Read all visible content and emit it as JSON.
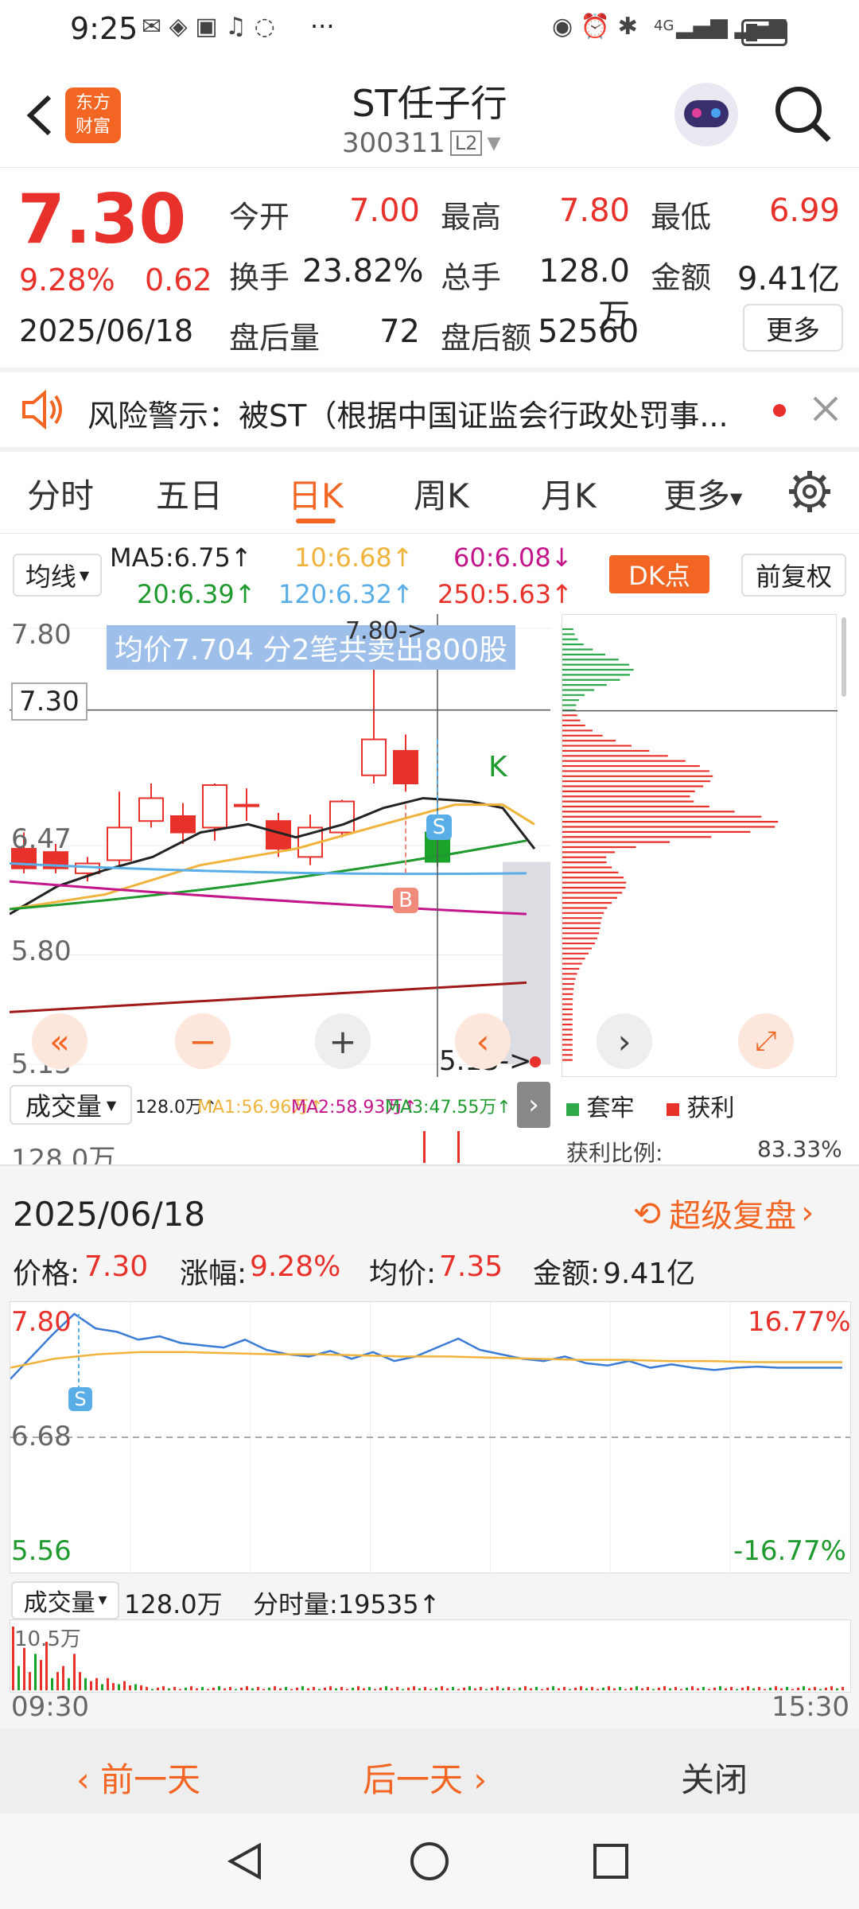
{
  "status_bar": {
    "time": "9:25",
    "dots": "···",
    "net": "4G"
  },
  "header": {
    "logo_line1": "东方",
    "logo_line2": "财富",
    "title": "ST任子行",
    "code": "300311",
    "level": "L2"
  },
  "quote": {
    "price": "7.30",
    "change_pct": "9.28%",
    "change": "0.62",
    "date": "2025/06/18",
    "open_label": "今开",
    "open": "7.00",
    "high_label": "最高",
    "high": "7.80",
    "low_label": "最低",
    "low": "6.99",
    "turnover_label": "换手",
    "turnover": "23.82%",
    "volume_label": "总手",
    "volume": "128.0万",
    "amount_label": "金额",
    "amount": "9.41亿",
    "after_vol_label": "盘后量",
    "after_vol": "72",
    "after_amt_label": "盘后额",
    "after_amt": "52560",
    "more_btn": "更多"
  },
  "risk": {
    "text": "风险警示：被ST（根据中国证监会行政处罚事..."
  },
  "tabs": [
    "分时",
    "五日",
    "日K",
    "周K",
    "月K",
    "更多",
    ""
  ],
  "active_tab": 2,
  "ma": {
    "selector": "均线",
    "ma5": "MA5:6.75↑",
    "ma10": "10:6.68↑",
    "ma60": "60:6.08↓",
    "ma20": "20:6.39↑",
    "ma120": "120:6.32↑",
    "ma250": "250:5.63↑",
    "dk_btn": "DK点",
    "fq_btn": "前复权",
    "colors": {
      "ma5": "#222222",
      "ma10": "#f0b33c",
      "ma20": "#1f9a2e",
      "ma60": "#c3168a",
      "ma120": "#5aaee8",
      "ma250": "#a01818"
    }
  },
  "kchart": {
    "y_labels": [
      "7.80",
      "6.47",
      "5.80",
      "5.13"
    ],
    "crosshair_price": "7.30",
    "tooltip": "均价7.704  分2笔共卖出800股",
    "max_marker": "7.80->",
    "min_marker": "5.13->",
    "s_marker": "S",
    "b_marker": "B",
    "k_marker": "K",
    "candles": [
      {
        "o": 6.45,
        "c": 6.33,
        "h": 6.55,
        "l": 6.3
      },
      {
        "o": 6.43,
        "c": 6.33,
        "h": 6.48,
        "l": 6.3
      },
      {
        "o": 6.3,
        "c": 6.36,
        "h": 6.4,
        "l": 6.25
      },
      {
        "o": 6.38,
        "c": 6.58,
        "h": 6.8,
        "l": 6.35
      },
      {
        "o": 6.62,
        "c": 6.76,
        "h": 6.85,
        "l": 6.58
      },
      {
        "o": 6.65,
        "c": 6.55,
        "h": 6.73,
        "l": 6.48
      },
      {
        "o": 6.58,
        "c": 6.84,
        "h": 6.85,
        "l": 6.5
      },
      {
        "o": 6.72,
        "c": 6.72,
        "h": 6.82,
        "l": 6.62
      },
      {
        "o": 6.62,
        "c": 6.45,
        "h": 6.67,
        "l": 6.4
      },
      {
        "o": 6.4,
        "c": 6.58,
        "h": 6.66,
        "l": 6.35
      },
      {
        "o": 6.55,
        "c": 6.74,
        "h": 6.75,
        "l": 6.52
      },
      {
        "o": 6.9,
        "c": 7.12,
        "h": 7.8,
        "l": 6.85
      },
      {
        "o": 7.05,
        "c": 6.85,
        "h": 7.15,
        "l": 6.8
      },
      {
        "o": 6.55,
        "c": 6.37,
        "h": 6.6,
        "l": 6.34
      }
    ]
  },
  "chip": {
    "legend_trapped": "套牢",
    "legend_profit": "获利",
    "profit_ratio_label": "获利比例:",
    "profit_ratio": "83.33%"
  },
  "volume_bar": {
    "selector": "成交量",
    "vol": "128.0万↑",
    "ma1": "MA1:56.96万↑",
    "ma2": "MA2:58.93万↑",
    "ma3": "MA3:47.55万↑",
    "axis": "128.0万"
  },
  "intraday": {
    "date": "2025/06/18",
    "replay_btn": "超级复盘",
    "price_label": "价格:",
    "price": "7.30",
    "chg_label": "涨幅:",
    "chg": "9.28%",
    "avg_label": "均价:",
    "avg": "7.35",
    "amt_label": "金额:",
    "amt": "9.41亿",
    "y_top": "7.80",
    "y_mid": "6.68",
    "y_bot": "5.56",
    "pct_top": "16.77%",
    "pct_bot": "-16.77%",
    "s_marker": "S",
    "vol_selector": "成交量",
    "vol_total": "128.0万",
    "vol_minute": "分时量:19535↑",
    "vol_axis": "10.5万",
    "t_start": "09:30",
    "t_end": "15:30"
  },
  "bottom": {
    "prev": "前一天",
    "next": "后一天",
    "close": "关闭"
  }
}
